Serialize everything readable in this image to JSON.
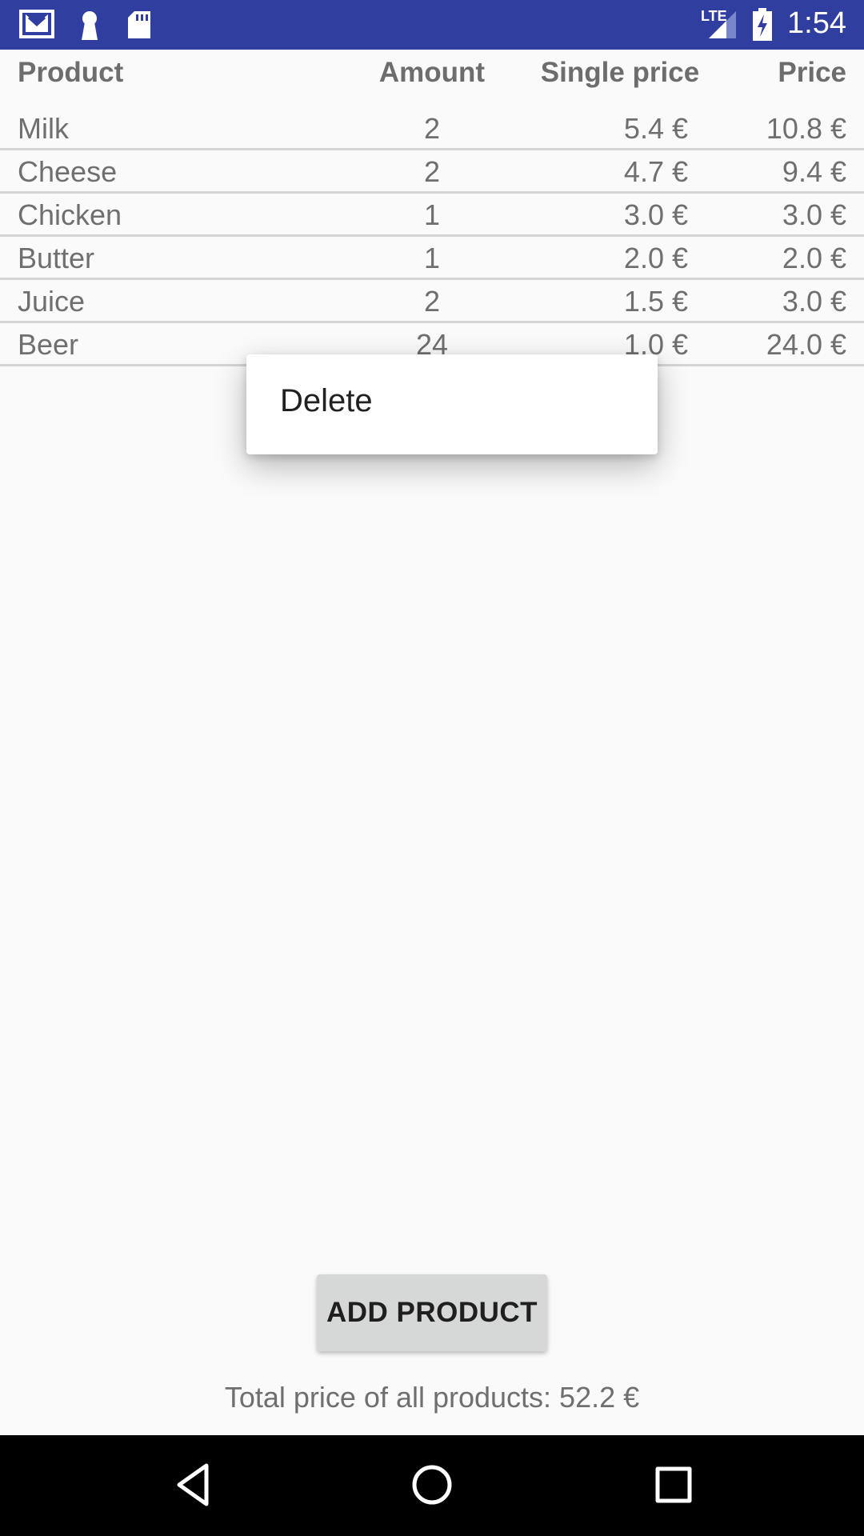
{
  "status_bar": {
    "time": "1:54",
    "network": "LTE",
    "icons": [
      "gmail-icon",
      "keyhole-icon",
      "sd-card-icon",
      "signal-icon",
      "battery-charging-icon"
    ]
  },
  "table": {
    "headers": [
      "Product",
      "Amount",
      "Single price",
      "Price"
    ],
    "rows": [
      {
        "product": "Milk",
        "amount": "2",
        "single": "5.4 €",
        "price": "10.8 €"
      },
      {
        "product": "Cheese",
        "amount": "2",
        "single": "4.7 €",
        "price": "9.4 €"
      },
      {
        "product": "Chicken",
        "amount": "1",
        "single": "3.0 €",
        "price": "3.0 €"
      },
      {
        "product": "Butter",
        "amount": "1",
        "single": "2.0 €",
        "price": "2.0 €"
      },
      {
        "product": "Juice",
        "amount": "2",
        "single": "1.5 €",
        "price": "3.0 €"
      },
      {
        "product": "Beer",
        "amount": "24",
        "single": "1.0 €",
        "price": "24.0 €"
      }
    ]
  },
  "context_menu": {
    "items": [
      "Delete"
    ]
  },
  "actions": {
    "add_product_label": "ADD PRODUCT"
  },
  "footer": {
    "total_text": "Total price of all products: 52.2 €"
  },
  "colors": {
    "status_bar": "#303f9f",
    "background": "#fafafa",
    "button": "#d6d7d7",
    "nav_bar": "#000000"
  }
}
